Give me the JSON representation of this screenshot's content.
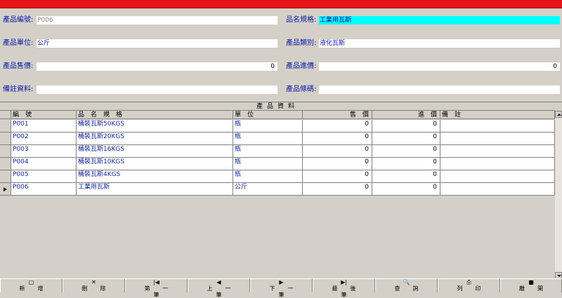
{
  "form": {
    "code_label": "產品編號:",
    "code_value": "P006",
    "spec_label": "品名規格:",
    "spec_value": "工業用瓦斯",
    "unit_label": "產品單位:",
    "unit_value": "公斤",
    "category_label": "產品類別:",
    "category_value": "液化瓦斯",
    "price_label": "產品售價:",
    "price_value": "0",
    "cost_label": "產品進價:",
    "cost_value": "0",
    "remark_label": "備註資料:",
    "remark_value": "",
    "barcode_label": "產品條碼:",
    "barcode_value": ""
  },
  "grid": {
    "caption": "產品資料",
    "headers": [
      "編　號",
      "品　名　規　格",
      "單　位",
      "售　價",
      "進　價",
      "備　註"
    ],
    "rows": [
      {
        "code": "P001",
        "spec": "桶裝瓦斯50KGS",
        "unit": "瓶",
        "price": "0",
        "cost": "0",
        "remark": ""
      },
      {
        "code": "P002",
        "spec": "桶裝瓦斯20KGS",
        "unit": "瓶",
        "price": "0",
        "cost": "0",
        "remark": ""
      },
      {
        "code": "P003",
        "spec": "桶裝瓦斯16KGS",
        "unit": "瓶",
        "price": "0",
        "cost": "0",
        "remark": ""
      },
      {
        "code": "P004",
        "spec": "桶裝瓦斯10KGS",
        "unit": "瓶",
        "price": "0",
        "cost": "0",
        "remark": ""
      },
      {
        "code": "P005",
        "spec": "桶裝瓦斯4KGS",
        "unit": "瓶",
        "price": "0",
        "cost": "0",
        "remark": ""
      },
      {
        "code": "P006",
        "spec": "工業用瓦斯",
        "unit": "公斤",
        "price": "0",
        "cost": "0",
        "remark": ""
      }
    ],
    "selected_row": 5
  },
  "toolbar": {
    "buttons": [
      {
        "label": "新增",
        "icon": "new-document-icon",
        "glyph": "▢"
      },
      {
        "label": "刪除",
        "icon": "delete-x-icon",
        "glyph": "✕"
      },
      {
        "label": "第一筆",
        "icon": "first-record-icon",
        "glyph": "|◀"
      },
      {
        "label": "上一筆",
        "icon": "previous-record-icon",
        "glyph": "◀"
      },
      {
        "label": "下一筆",
        "icon": "next-record-icon",
        "glyph": "▶"
      },
      {
        "label": "最後筆",
        "icon": "last-record-icon",
        "glyph": "▶|"
      },
      {
        "label": "查詢",
        "icon": "search-icon",
        "glyph": "🔍"
      },
      {
        "label": "列印",
        "icon": "printer-icon",
        "glyph": "⎙"
      },
      {
        "label": "離開",
        "icon": "save-disk-icon",
        "glyph": "■"
      }
    ]
  },
  "colors": {
    "title_bar": "#e8141c",
    "label_text": "#0a1aa8",
    "highlight_field": "#00ffff",
    "window_bg": "#d4d0c8"
  }
}
